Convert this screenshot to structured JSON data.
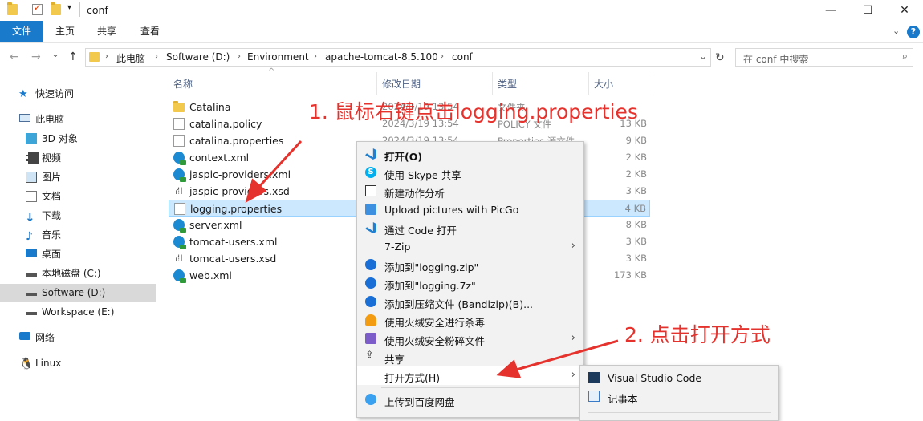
{
  "window": {
    "title": "conf",
    "controls": {
      "minimize": "—",
      "maximize": "☐",
      "close": "✕"
    }
  },
  "ribbon": {
    "tabs": [
      "文件",
      "主页",
      "共享",
      "查看"
    ],
    "expand_icon": "chevron-down-icon",
    "help_icon": "?"
  },
  "nav_buttons": {
    "back": "←",
    "forward": "→",
    "recent": "⌄",
    "up": "↑"
  },
  "address": {
    "crumbs": [
      "此电脑",
      "Software (D:)",
      "Environment",
      "apache-tomcat-8.5.100",
      "conf"
    ]
  },
  "search": {
    "placeholder": "在 conf 中搜索"
  },
  "nav_pane": {
    "items": [
      {
        "label": "快速访问",
        "icon": "star-icon"
      },
      {
        "label": "此电脑",
        "icon": "computer-icon"
      },
      {
        "label": "3D 对象",
        "icon": "cube-icon"
      },
      {
        "label": "视频",
        "icon": "video-icon"
      },
      {
        "label": "图片",
        "icon": "picture-icon"
      },
      {
        "label": "文档",
        "icon": "document-icon"
      },
      {
        "label": "下载",
        "icon": "download-icon"
      },
      {
        "label": "音乐",
        "icon": "music-icon"
      },
      {
        "label": "桌面",
        "icon": "desktop-icon"
      },
      {
        "label": "本地磁盘 (C:)",
        "icon": "drive-icon"
      },
      {
        "label": "Software (D:)",
        "icon": "drive-icon"
      },
      {
        "label": "Workspace (E:)",
        "icon": "drive-icon"
      },
      {
        "label": "网络",
        "icon": "network-icon"
      },
      {
        "label": "Linux",
        "icon": "linux-icon"
      }
    ]
  },
  "columns": {
    "name": "名称",
    "date": "修改日期",
    "type": "类型",
    "size": "大小"
  },
  "files": [
    {
      "name": "Catalina",
      "date": "2024/3/19 13:54",
      "type": "文件夹",
      "size": ""
    },
    {
      "name": "catalina.policy",
      "date": "2024/3/19 13:54",
      "type": "POLICY 文件",
      "size": "13 KB"
    },
    {
      "name": "catalina.properties",
      "date": "2024/3/19 13:54",
      "type": "Properties 源文件",
      "size": "9 KB"
    },
    {
      "name": "context.xml",
      "date": "",
      "type": "",
      "size": "2 KB"
    },
    {
      "name": "jaspic-providers.xml",
      "date": "",
      "type": "",
      "size": "2 KB"
    },
    {
      "name": "jaspic-providers.xsd",
      "date": "",
      "type": "",
      "size": "3 KB"
    },
    {
      "name": "logging.properties",
      "date": "",
      "type": "",
      "size": "4 KB"
    },
    {
      "name": "server.xml",
      "date": "",
      "type": "",
      "size": "8 KB"
    },
    {
      "name": "tomcat-users.xml",
      "date": "",
      "type": "",
      "size": "3 KB"
    },
    {
      "name": "tomcat-users.xsd",
      "date": "",
      "type": "",
      "size": "3 KB"
    },
    {
      "name": "web.xml",
      "date": "",
      "type": "",
      "size": "173 KB"
    }
  ],
  "context_menu": {
    "items": [
      {
        "label": "打开(O)",
        "icon": "vscode-icon",
        "bold": true
      },
      {
        "label": "使用 Skype 共享",
        "icon": "skype-icon"
      },
      {
        "label": "新建动作分析",
        "icon": "analysis-icon"
      },
      {
        "label": "Upload pictures with PicGo",
        "icon": "picgo-icon"
      },
      {
        "label": "通过 Code 打开",
        "icon": "vscode-icon"
      },
      {
        "label": "7-Zip",
        "icon": "",
        "submenu": true
      },
      {
        "label": "添加到\"logging.zip\"",
        "icon": "bandizip-icon"
      },
      {
        "label": "添加到\"logging.7z\"",
        "icon": "bandizip-icon"
      },
      {
        "label": "添加到压缩文件 (Bandizip)(B)...",
        "icon": "bandizip-icon"
      },
      {
        "label": "使用火绒安全进行杀毒",
        "icon": "huorong-icon"
      },
      {
        "label": "使用火绒安全粉碎文件",
        "icon": "shredder-icon",
        "submenu": true
      },
      {
        "label": "共享",
        "icon": "share-icon"
      },
      {
        "label": "打开方式(H)",
        "icon": "",
        "submenu": true,
        "highlighted": true
      },
      {
        "label": "上传到百度网盘",
        "icon": "baidu-icon"
      }
    ]
  },
  "submenu": {
    "items": [
      {
        "label": "Visual Studio Code",
        "icon": "vscode-icon"
      },
      {
        "label": "记事本",
        "icon": "notepad-icon"
      }
    ]
  },
  "annotations": {
    "step1": "1. 鼠标右键点击logging.properties",
    "step2": "2. 点击打开方式"
  },
  "colors": {
    "accent": "#1979ca",
    "selection": "#cce8ff",
    "annotation": "#e5322d"
  }
}
